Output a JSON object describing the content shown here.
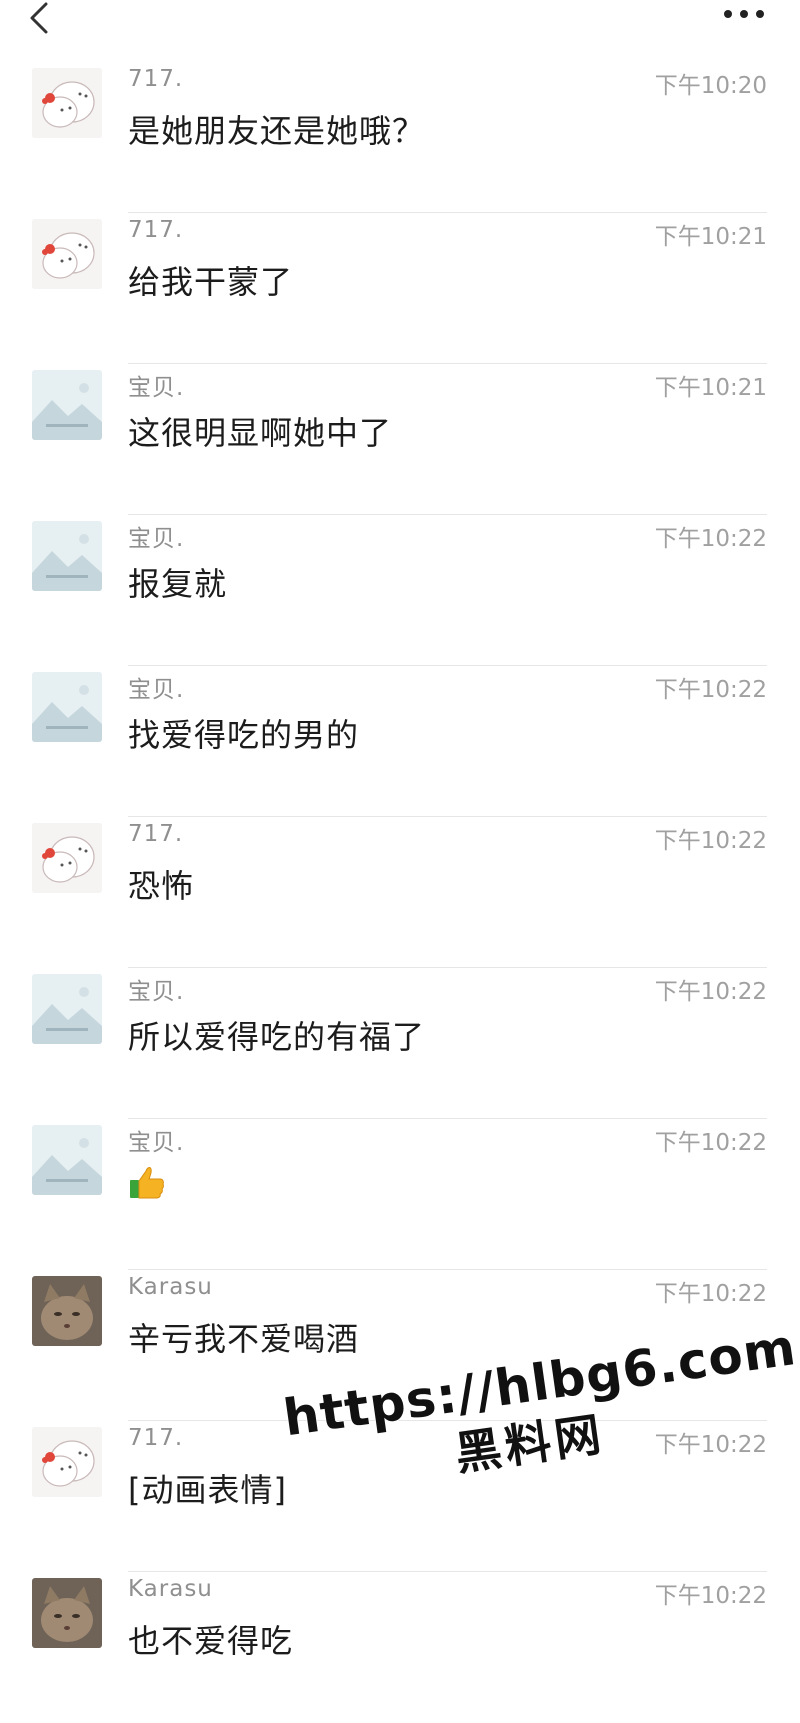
{
  "header": {
    "back_icon": "chevron-left-icon",
    "more_icon": "more-dots-icon"
  },
  "messages": [
    {
      "sender": "717.",
      "time": "下午10:20",
      "text": "是她朋友还是她哦？",
      "avatar": "cartoon-avatar"
    },
    {
      "sender": "717.",
      "time": "下午10:21",
      "text": "给我干蒙了",
      "avatar": "cartoon-avatar"
    },
    {
      "sender": "宝贝.",
      "time": "下午10:21",
      "text": "这很明显啊她中了",
      "avatar": "landscape-avatar"
    },
    {
      "sender": "宝贝.",
      "time": "下午10:22",
      "text": "报复就",
      "avatar": "landscape-avatar"
    },
    {
      "sender": "宝贝.",
      "time": "下午10:22",
      "text": "找爱得吃的男的",
      "avatar": "landscape-avatar"
    },
    {
      "sender": "717.",
      "time": "下午10:22",
      "text": "恐怖",
      "avatar": "cartoon-avatar"
    },
    {
      "sender": "宝贝.",
      "time": "下午10:22",
      "text": "所以爱得吃的有福了",
      "avatar": "landscape-avatar"
    },
    {
      "sender": "宝贝.",
      "time": "下午10:22",
      "text": "",
      "emoji": "thumbs-up-icon",
      "avatar": "landscape-avatar"
    },
    {
      "sender": "Karasu",
      "time": "下午10:22",
      "text": "辛亏我不爱喝酒",
      "avatar": "cat-avatar"
    },
    {
      "sender": "717.",
      "time": "下午10:22",
      "text": "[动画表情]",
      "avatar": "cartoon-avatar"
    },
    {
      "sender": "Karasu",
      "time": "下午10:22",
      "text": "也不爱得吃",
      "avatar": "cat-avatar"
    }
  ],
  "watermark": {
    "url": "https://hlbg6.com",
    "name": "黑料网"
  }
}
